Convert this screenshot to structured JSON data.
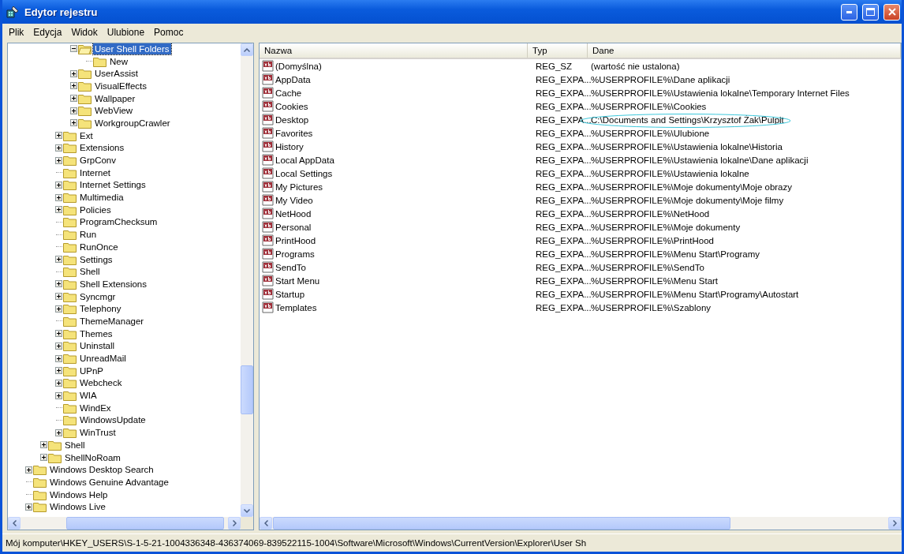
{
  "window": {
    "title": "Edytor rejestru"
  },
  "menu": [
    "Plik",
    "Edycja",
    "Widok",
    "Ulubione",
    "Pomoc"
  ],
  "tree": [
    {
      "children": [
        {
          "children": [
            {
              "children": [
                {
                  "label": "User Shell Folders",
                  "kind": "branch",
                  "expanded": true,
                  "selected": true,
                  "children": [
                    {
                      "label": "New",
                      "kind": "leaf",
                      "selected": false
                    }
                  ]
                },
                {
                  "label": "UserAssist",
                  "kind": "branch",
                  "expanded": false,
                  "selected": false
                },
                {
                  "label": "VisualEffects",
                  "kind": "branch",
                  "expanded": false,
                  "selected": false
                },
                {
                  "label": "Wallpaper",
                  "kind": "branch",
                  "expanded": false,
                  "selected": false
                },
                {
                  "label": "WebView",
                  "kind": "branch",
                  "expanded": false,
                  "selected": false
                },
                {
                  "label": "WorkgroupCrawler",
                  "kind": "branch",
                  "expanded": false,
                  "selected": false
                }
              ]
            },
            {
              "label": "Ext",
              "kind": "branch",
              "expanded": false,
              "selected": false
            },
            {
              "label": "Extensions",
              "kind": "branch",
              "expanded": false,
              "selected": false
            },
            {
              "label": "GrpConv",
              "kind": "branch",
              "expanded": false,
              "selected": false
            },
            {
              "label": "Internet",
              "kind": "leaf",
              "selected": false
            },
            {
              "label": "Internet Settings",
              "kind": "branch",
              "expanded": false,
              "selected": false
            },
            {
              "label": "Multimedia",
              "kind": "branch",
              "expanded": false,
              "selected": false
            },
            {
              "label": "Policies",
              "kind": "branch",
              "expanded": false,
              "selected": false
            },
            {
              "label": "ProgramChecksum",
              "kind": "leaf",
              "selected": false
            },
            {
              "label": "Run",
              "kind": "leaf",
              "selected": false
            },
            {
              "label": "RunOnce",
              "kind": "leaf",
              "selected": false
            },
            {
              "label": "Settings",
              "kind": "branch",
              "expanded": false,
              "selected": false
            },
            {
              "label": "Shell",
              "kind": "leaf",
              "selected": false
            },
            {
              "label": "Shell Extensions",
              "kind": "branch",
              "expanded": false,
              "selected": false
            },
            {
              "label": "Syncmgr",
              "kind": "branch",
              "expanded": false,
              "selected": false
            },
            {
              "label": "Telephony",
              "kind": "branch",
              "expanded": false,
              "selected": false
            },
            {
              "label": "ThemeManager",
              "kind": "leaf",
              "selected": false
            },
            {
              "label": "Themes",
              "kind": "branch",
              "expanded": false,
              "selected": false
            },
            {
              "label": "Uninstall",
              "kind": "branch",
              "expanded": false,
              "selected": false
            },
            {
              "label": "UnreadMail",
              "kind": "branch",
              "expanded": false,
              "selected": false
            },
            {
              "label": "UPnP",
              "kind": "branch",
              "expanded": false,
              "selected": false
            },
            {
              "label": "Webcheck",
              "kind": "branch",
              "expanded": false,
              "selected": false
            },
            {
              "label": "WIA",
              "kind": "branch",
              "expanded": false,
              "selected": false
            },
            {
              "label": "WindEx",
              "kind": "leaf",
              "selected": false
            },
            {
              "label": "WindowsUpdate",
              "kind": "leaf",
              "selected": false
            },
            {
              "label": "WinTrust",
              "kind": "branch",
              "expanded": false,
              "selected": false
            }
          ]
        },
        {
          "label": "Shell",
          "kind": "branch",
          "expanded": false,
          "selected": false
        },
        {
          "label": "ShellNoRoam",
          "kind": "branch",
          "expanded": false,
          "selected": false
        }
      ]
    },
    {
      "label": "Windows Desktop Search",
      "kind": "branch",
      "expanded": false,
      "selected": false
    },
    {
      "label": "Windows Genuine Advantage",
      "kind": "leaf",
      "selected": false
    },
    {
      "label": "Windows Help",
      "kind": "leaf",
      "selected": false
    },
    {
      "label": "Windows Live",
      "kind": "branch",
      "expanded": false,
      "selected": false
    }
  ],
  "table": {
    "columns": [
      "Nazwa",
      "Typ",
      "Dane"
    ],
    "rows": [
      {
        "name": "(Domyślna)",
        "type": "REG_SZ",
        "data": "(wartość nie ustalona)",
        "circled": false
      },
      {
        "name": "AppData",
        "type": "REG_EXPA...",
        "data": "%USERPROFILE%\\Dane aplikacji",
        "circled": false
      },
      {
        "name": "Cache",
        "type": "REG_EXPA...",
        "data": "%USERPROFILE%\\Ustawienia lokalne\\Temporary Internet Files",
        "circled": false
      },
      {
        "name": "Cookies",
        "type": "REG_EXPA...",
        "data": "%USERPROFILE%\\Cookies",
        "circled": false
      },
      {
        "name": "Desktop",
        "type": "REG_EXPA...",
        "data": "C:\\Documents and Settings\\Krzysztof Żak\\Pulpit",
        "circled": true
      },
      {
        "name": "Favorites",
        "type": "REG_EXPA...",
        "data": "%USERPROFILE%\\Ulubione",
        "circled": false
      },
      {
        "name": "History",
        "type": "REG_EXPA...",
        "data": "%USERPROFILE%\\Ustawienia lokalne\\Historia",
        "circled": false
      },
      {
        "name": "Local AppData",
        "type": "REG_EXPA...",
        "data": "%USERPROFILE%\\Ustawienia lokalne\\Dane aplikacji",
        "circled": false
      },
      {
        "name": "Local Settings",
        "type": "REG_EXPA...",
        "data": "%USERPROFILE%\\Ustawienia lokalne",
        "circled": false
      },
      {
        "name": "My Pictures",
        "type": "REG_EXPA...",
        "data": "%USERPROFILE%\\Moje dokumenty\\Moje obrazy",
        "circled": false
      },
      {
        "name": "My Video",
        "type": "REG_EXPA...",
        "data": "%USERPROFILE%\\Moje dokumenty\\Moje filmy",
        "circled": false
      },
      {
        "name": "NetHood",
        "type": "REG_EXPA...",
        "data": "%USERPROFILE%\\NetHood",
        "circled": false
      },
      {
        "name": "Personal",
        "type": "REG_EXPA...",
        "data": "%USERPROFILE%\\Moje dokumenty",
        "circled": false
      },
      {
        "name": "PrintHood",
        "type": "REG_EXPA...",
        "data": "%USERPROFILE%\\PrintHood",
        "circled": false
      },
      {
        "name": "Programs",
        "type": "REG_EXPA...",
        "data": "%USERPROFILE%\\Menu Start\\Programy",
        "circled": false
      },
      {
        "name": "SendTo",
        "type": "REG_EXPA...",
        "data": "%USERPROFILE%\\SendTo",
        "circled": false
      },
      {
        "name": "Start Menu",
        "type": "REG_EXPA...",
        "data": "%USERPROFILE%\\Menu Start",
        "circled": false
      },
      {
        "name": "Startup",
        "type": "REG_EXPA...",
        "data": "%USERPROFILE%\\Menu Start\\Programy\\Autostart",
        "circled": false
      },
      {
        "name": "Templates",
        "type": "REG_EXPA...",
        "data": "%USERPROFILE%\\Szablony",
        "circled": false
      }
    ]
  },
  "status_bar": "Mój komputer\\HKEY_USERS\\S-1-5-21-1004336348-436374069-839522115-1004\\Software\\Microsoft\\Windows\\CurrentVersion\\Explorer\\User Sh"
}
